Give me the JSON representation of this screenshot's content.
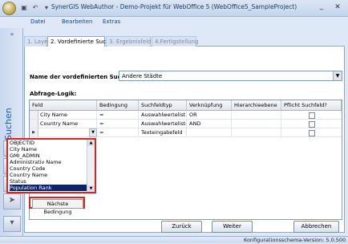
{
  "window": {
    "title": "SynerGIS WebAuthor - Demo-Projekt für WebOffice 5 (WebOffice5_SampleProject)",
    "minimize_glyph": "_",
    "close_glyph": "✕"
  },
  "quick_access": {
    "icons": [
      "save-icon",
      "undo-icon",
      "dropdown-icon"
    ],
    "glyphs": [
      "▣",
      "↶",
      "▾"
    ]
  },
  "menu": [
    "Datei",
    "Bearbeiten",
    "Extras"
  ],
  "sidebar": {
    "collapse_glyph": "»",
    "label": "Suchen",
    "icons": [
      "globe-icon",
      "toolbox-icon",
      "search-icon",
      "pointer-icon",
      "settings-icon"
    ],
    "icon_glyphs": [
      "◍",
      "▦",
      "⌕",
      "➤",
      "▾"
    ]
  },
  "tabs": [
    "1. Layer",
    "2. Vordefinierte Suche",
    "3. Ergebnisfelder",
    "4.Fertigstellung"
  ],
  "active_tab": 1,
  "form": {
    "search_label": "Name der vordefinierten Suche:",
    "search_value": "Andere Städte",
    "logic_label": "Abfrage-Logik:"
  },
  "grid": {
    "columns": [
      "Feld",
      "Bedingung",
      "Suchfeldtyp",
      "Verknüpfung",
      "Hierarchieebene",
      "Pflicht Suchfeld?"
    ],
    "rows": [
      {
        "marker": "",
        "feld": "City Name",
        "bedingung": "=",
        "typ": "Auswahlwertelist...",
        "verknuepfung": "OR",
        "ebene": "",
        "pflicht": false
      },
      {
        "marker": "",
        "feld": "Country Name",
        "bedingung": "=",
        "typ": "Auswahlwerteliste",
        "verknuepfung": "AND",
        "ebene": "",
        "pflicht": false
      },
      {
        "marker": "▶",
        "feld": "",
        "bedingung": "=",
        "typ": "Texteingabefeld",
        "verknuepfung": "",
        "ebene": "",
        "pflicht": false
      }
    ]
  },
  "field_list": {
    "items": [
      "OBJECTID",
      "City Name",
      "GMI_ADMIN",
      "Administrativ Name",
      "Country Code",
      "Country Name",
      "Status",
      "Population Rank"
    ],
    "selected_index": 7
  },
  "buttons": {
    "next_condition": "Nächste Bedingung",
    "back": "Zurück",
    "next": "Weiter",
    "cancel": "Abbrechen"
  },
  "status": {
    "text": "Konfigurationsschema-Version: 5.0.500"
  },
  "colors": {
    "accent": "#15428b",
    "highlight": "#d22222",
    "selection": "#0a246a"
  }
}
